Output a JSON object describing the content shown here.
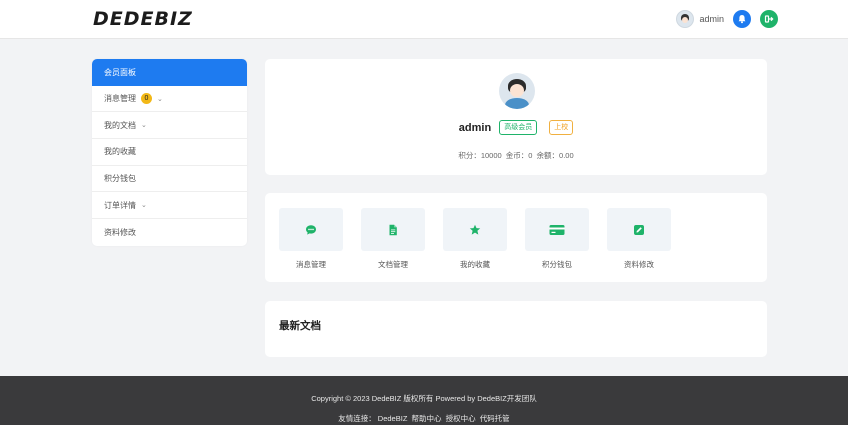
{
  "brand": {
    "logo_text": "DEDEBIZ"
  },
  "topbar": {
    "username": "admin"
  },
  "sidebar": {
    "items": [
      {
        "label": "会员面板"
      },
      {
        "label": "消息管理",
        "badge": "0"
      },
      {
        "label": "我的文档"
      },
      {
        "label": "我的收藏"
      },
      {
        "label": "积分钱包"
      },
      {
        "label": "订单详情"
      },
      {
        "label": "资料修改"
      }
    ]
  },
  "profile": {
    "name": "admin",
    "level_tag": "高级会员",
    "rank_tag": "上校",
    "stats_text": "积分：10000  金币：0  余额：0.00"
  },
  "quick_menu": {
    "items": [
      {
        "label": "消息管理",
        "icon": "chat-icon"
      },
      {
        "label": "文档管理",
        "icon": "document-icon"
      },
      {
        "label": "我的收藏",
        "icon": "star-icon"
      },
      {
        "label": "积分钱包",
        "icon": "credit-card-icon"
      },
      {
        "label": "资料修改",
        "icon": "edit-icon"
      }
    ]
  },
  "recent": {
    "title": "最新文档"
  },
  "footer": {
    "copyright": "Copyright © 2023 DedeBIZ 版权所有 Powered by DedeBIZ开发团队",
    "links_prefix": "友情连接：",
    "links": [
      "DedeBIZ",
      "帮助中心",
      "授权中心",
      "代码托管"
    ]
  },
  "colors": {
    "primary": "#1e7bf0",
    "success": "#1fb36a",
    "warning": "#f2b817",
    "footer_bg": "#3a3a3c"
  }
}
